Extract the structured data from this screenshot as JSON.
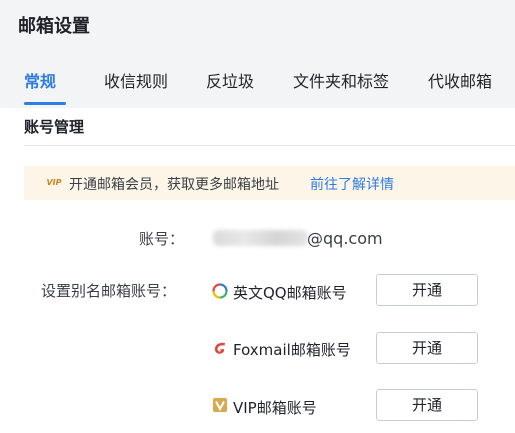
{
  "page": {
    "title": "邮箱设置"
  },
  "tabs": [
    {
      "label": "常规",
      "active": true
    },
    {
      "label": "收信规则",
      "active": false
    },
    {
      "label": "反垃圾",
      "active": false
    },
    {
      "label": "文件夹和标签",
      "active": false
    },
    {
      "label": "代收邮箱",
      "active": false
    }
  ],
  "account_section": {
    "title": "账号管理",
    "vip_banner": {
      "badge": "VIP",
      "text": "开通邮箱会员，获取更多邮箱地址",
      "link": "前往了解详情"
    },
    "account": {
      "label": "账号：",
      "domain": "@qq.com"
    },
    "alias": {
      "label": "设置别名邮箱账号：",
      "items": [
        {
          "name": "英文QQ邮箱账号",
          "icon": "qq-color-icon",
          "button": "开通"
        },
        {
          "name": "Foxmail邮箱账号",
          "icon": "foxmail-icon",
          "button": "开通"
        },
        {
          "name": "VIP邮箱账号",
          "icon": "vip-mailbox-icon",
          "button": "开通"
        }
      ]
    }
  },
  "colors": {
    "accent": "#2f7de1",
    "header_bg": "#f3f4f6",
    "banner_bg": "#fdf5e8",
    "vip_gold": "#c8841e",
    "foxmail_red": "#e0463b"
  }
}
